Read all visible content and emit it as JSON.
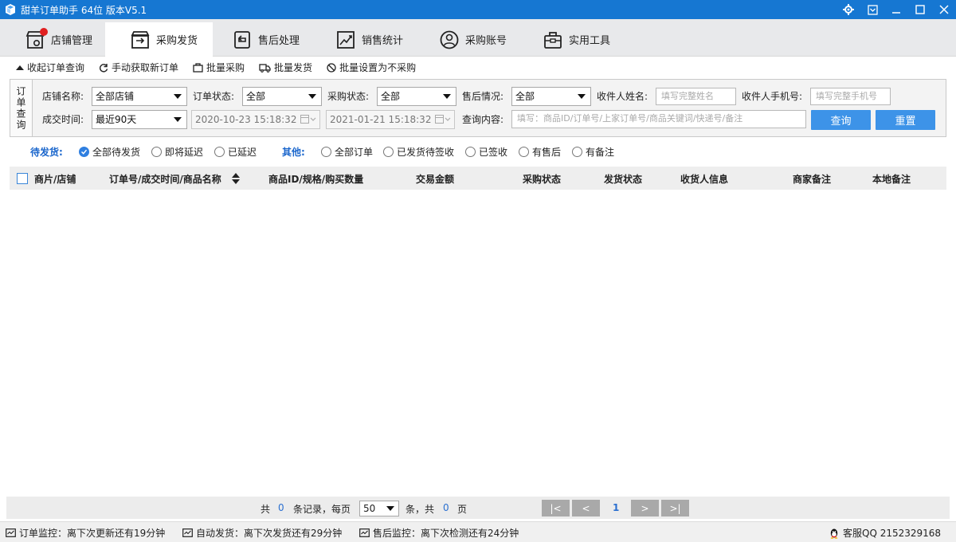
{
  "window": {
    "title": "甜羊订单助手 64位  版本V5.1"
  },
  "nav": {
    "tabs": [
      {
        "label": "店铺管理",
        "icon": "store-settings-icon"
      },
      {
        "label": "采购发货",
        "icon": "purchase-ship-icon"
      },
      {
        "label": "售后处理",
        "icon": "return-icon"
      },
      {
        "label": "销售统计",
        "icon": "chart-icon"
      },
      {
        "label": "采购账号",
        "icon": "user-icon"
      },
      {
        "label": "实用工具",
        "icon": "toolbox-icon"
      }
    ],
    "active_index": 1
  },
  "toolbar": {
    "collapse_query": "收起订单查询",
    "fetch_orders": "手动获取新订单",
    "batch_purchase": "批量采购",
    "batch_ship": "批量发货",
    "batch_no_purchase": "批量设置为不采购"
  },
  "query": {
    "side_label": "订单查询",
    "store_label": "店铺名称:",
    "store_value": "全部店铺",
    "order_status_label": "订单状态:",
    "order_status_value": "全部",
    "purchase_status_label": "采购状态:",
    "purchase_status_value": "全部",
    "aftersale_label": "售后情况:",
    "aftersale_value": "全部",
    "receiver_name_label": "收件人姓名:",
    "receiver_name_placeholder": "填写完整姓名",
    "receiver_phone_label": "收件人手机号:",
    "receiver_phone_placeholder": "填写完整手机号",
    "deal_time_label": "成交时间:",
    "deal_time_value": "最近90天",
    "date_from": "2020-10-23 15:18:32",
    "date_to": "2021-01-21 15:18:32",
    "content_label": "查询内容:",
    "content_placeholder": "填写：商品ID/订单号/上家订单号/商品关键词/快递号/备注",
    "search_button": "查询",
    "reset_button": "重置"
  },
  "filters": {
    "pending_title": "待发货:",
    "pending_options": [
      "全部待发货",
      "即将延迟",
      "已延迟"
    ],
    "pending_selected": 0,
    "other_title": "其他:",
    "other_options": [
      "全部订单",
      "已发货待签收",
      "已签收",
      "有售后",
      "有备注"
    ]
  },
  "table": {
    "columns": [
      "商片/店铺",
      "订单号/成交时间/商品名称",
      "商品ID/规格/购买数量",
      "交易金额",
      "采购状态",
      "发货状态",
      "收货人信息",
      "商家备注",
      "本地备注"
    ]
  },
  "pager": {
    "total_prefix": "共",
    "total_count": "0",
    "records_per_page": "条记录，每页",
    "page_size": "50",
    "pages_label": "条，共",
    "page_count": "0",
    "page_suffix": "页",
    "first": "|<",
    "prev": "<",
    "current": "1",
    "next": ">",
    "last": ">|"
  },
  "status": {
    "order_monitor": "订单监控：离下次更新还有19分钟",
    "auto_ship": "自动发货：离下次发货还有29分钟",
    "aftersale_monitor": "售后监控：离下次检测还有24分钟",
    "support_qq": "客服QQ 2152329168"
  },
  "colors": {
    "titlebar": "#1677d2",
    "primary_button": "#3d93e8",
    "accent_text": "#1a66cc"
  }
}
